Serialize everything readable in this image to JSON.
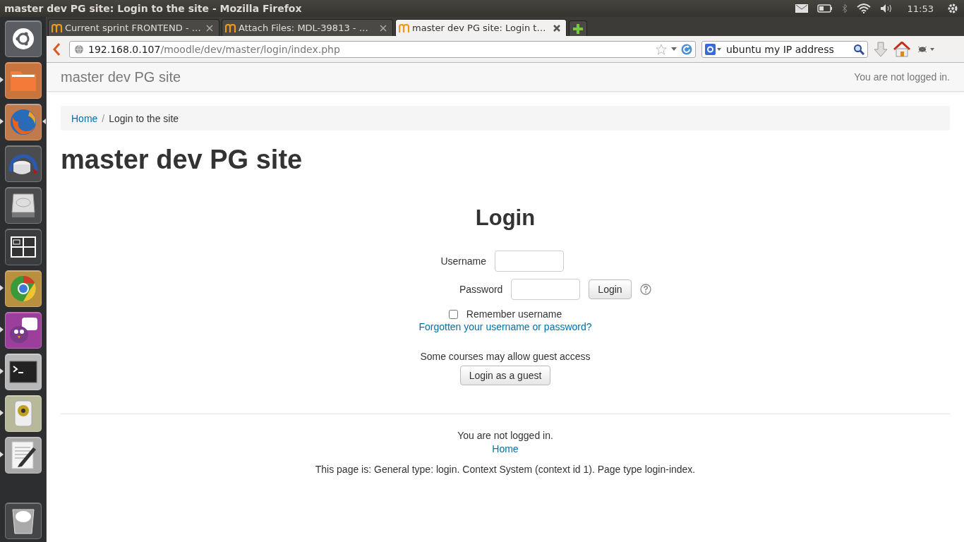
{
  "window": {
    "title": "master dev PG site: Login to the site - Mozilla Firefox"
  },
  "top_panel": {
    "clock": "11:53"
  },
  "launcher": [
    {
      "kind": "dash",
      "running": false,
      "focused": false
    },
    {
      "kind": "files",
      "running": true,
      "focused": false
    },
    {
      "kind": "firefox",
      "running": true,
      "focused": true
    },
    {
      "kind": "disk-usage",
      "running": false,
      "focused": false
    },
    {
      "kind": "disk",
      "running": false,
      "focused": false
    },
    {
      "kind": "workspaces",
      "running": false,
      "focused": false
    },
    {
      "kind": "chrome",
      "running": true,
      "focused": false
    },
    {
      "kind": "chat",
      "running": true,
      "focused": false
    },
    {
      "kind": "terminal",
      "running": true,
      "focused": false
    },
    {
      "kind": "speaker",
      "running": true,
      "focused": false
    },
    {
      "kind": "editor",
      "running": true,
      "focused": false
    },
    {
      "kind": "trash",
      "running": false,
      "focused": false
    }
  ],
  "tabs": [
    {
      "label": "Current sprint FRONTEND - …",
      "selected": false
    },
    {
      "label": "Attach Files:  MDL-39813 - …",
      "selected": false
    },
    {
      "label": "master dev PG site: Login t…",
      "selected": true
    }
  ],
  "url": {
    "host": "192.168.0.107",
    "path": "/moodle/dev/master/login/index.php"
  },
  "search": {
    "value": "ubuntu my IP address"
  },
  "page": {
    "site_name": "master dev PG site",
    "login_status": "You are not logged in.",
    "breadcrumb_separator": "/",
    "breadcrumb": [
      {
        "label": "Home",
        "link": true
      },
      {
        "label": "Login to the site",
        "link": false
      }
    ],
    "heading": "master dev PG site",
    "login": {
      "title": "Login",
      "username_label": "Username",
      "password_label": "Password",
      "login_button": "Login",
      "remember": {
        "label": "Remember username",
        "checked": false
      },
      "forgot_link": "Forgotten your username or password?",
      "guest_note": "Some courses may allow guest access",
      "guest_button": "Login as a guest"
    },
    "footer": {
      "status": "You are not logged in.",
      "home_link": "Home",
      "page_info": "This page is: General type: login. Context System (context id 1). Page type login-index."
    }
  }
}
